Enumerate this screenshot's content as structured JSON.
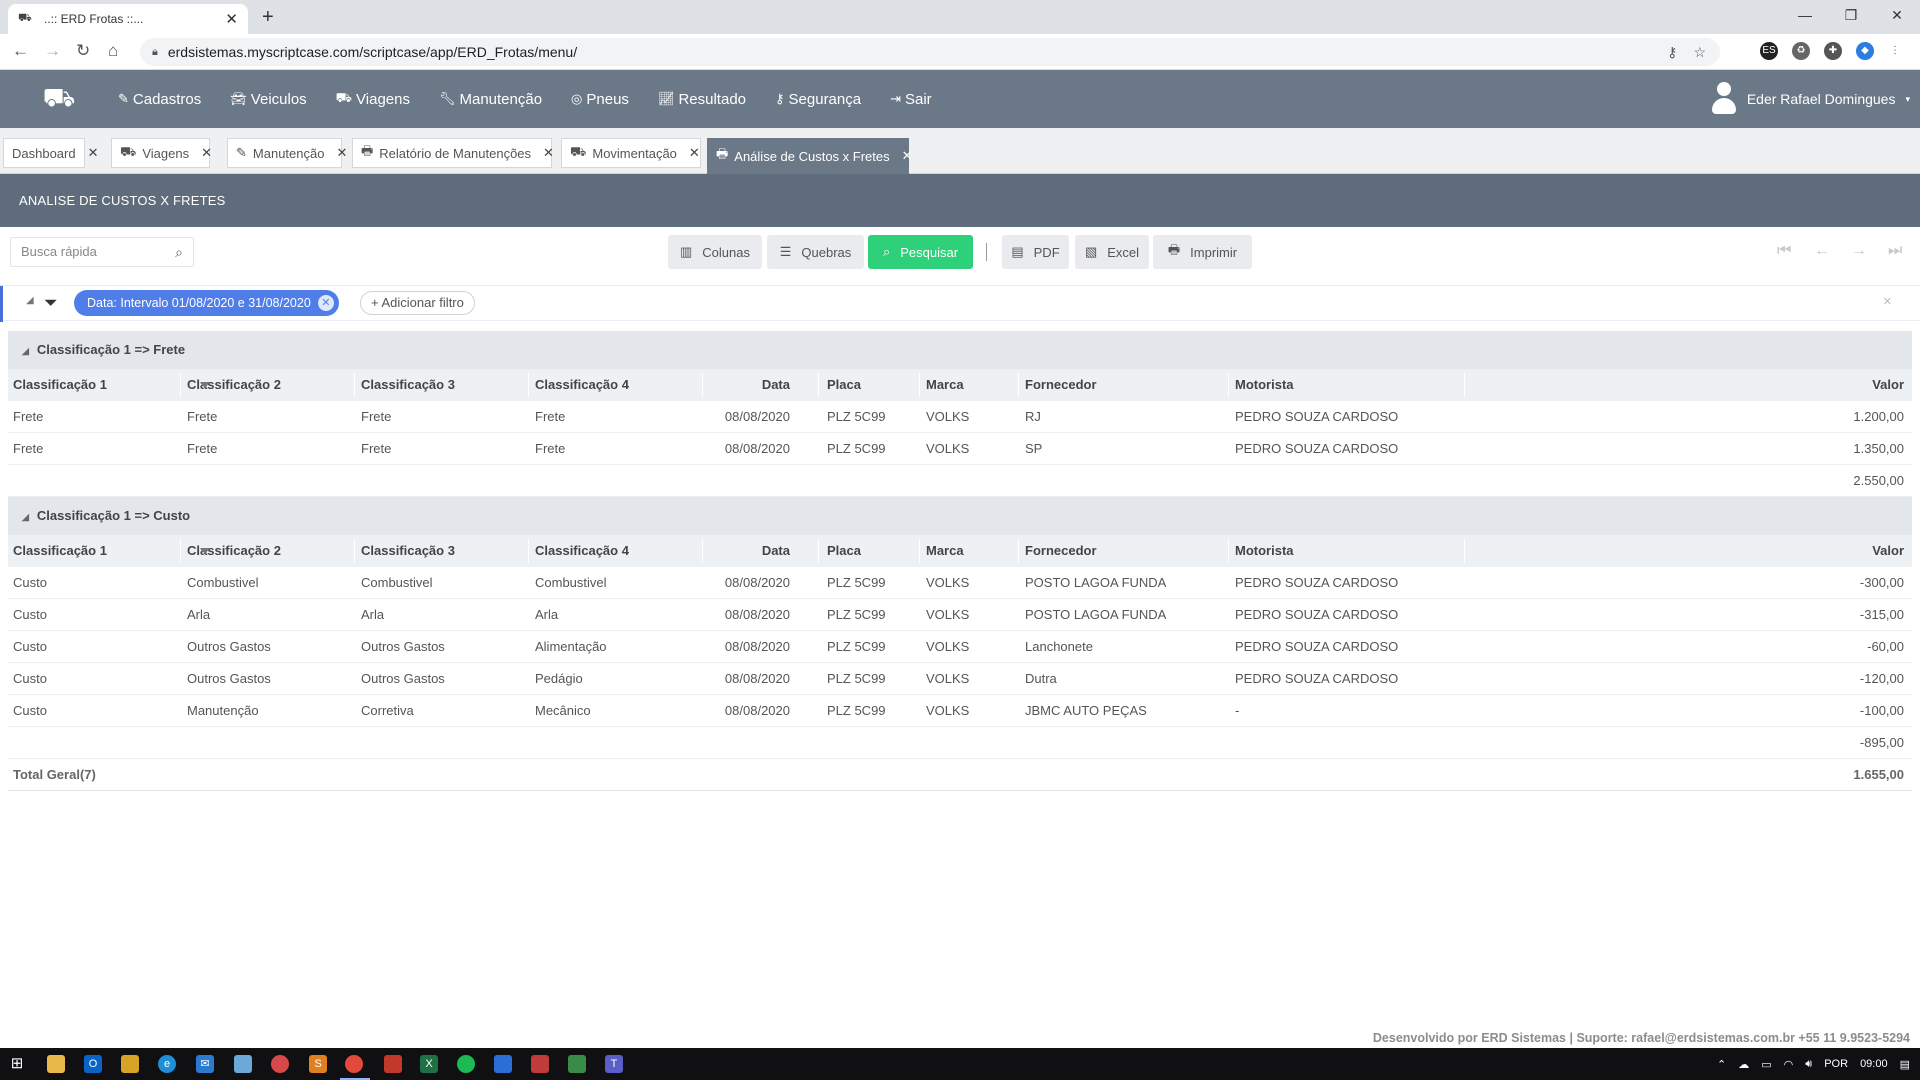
{
  "browser": {
    "tab_title": "..:: ERD Frotas ::...",
    "url": "erdsistemas.myscriptcase.com/scriptcase/app/ERD_Frotas/menu/"
  },
  "app": {
    "nav": [
      {
        "label": "Cadastros",
        "icon": "edit-icon"
      },
      {
        "label": "Veiculos",
        "icon": "car-icon"
      },
      {
        "label": "Viagens",
        "icon": "truck-icon"
      },
      {
        "label": "Manutenção",
        "icon": "wrench-icon"
      },
      {
        "label": "Pneus",
        "icon": "tire-icon"
      },
      {
        "label": "Resultado",
        "icon": "chart-icon"
      },
      {
        "label": "Segurança",
        "icon": "key-icon"
      },
      {
        "label": "Sair",
        "icon": "exit-icon"
      }
    ],
    "user_name": "Eder Rafael Domingues",
    "tabs": [
      "Dashboard",
      "Viagens",
      "Manutenção",
      "Relatório de Manutenções",
      "Movimentação",
      "Análise de Custos x Fretes"
    ],
    "page_title": "ANALISE DE CUSTOS X FRETES"
  },
  "toolbar": {
    "search_placeholder": "Busca rápida",
    "columns": "Colunas",
    "breaks": "Quebras",
    "search": "Pesquisar",
    "pdf": "PDF",
    "excel": "Excel",
    "print": "Imprimir"
  },
  "filter": {
    "chip": "Data: Intervalo 01/08/2020 e 31/08/2020",
    "add": "Adicionar filtro"
  },
  "columns": [
    "Classificação 1",
    "Classificação 2",
    "Classificação 3",
    "Classificação 4",
    "Data",
    "Placa",
    "Marca",
    "Fornecedor",
    "Motorista",
    "Valor"
  ],
  "groups": [
    {
      "title": "Classificação 1 => Frete",
      "rows": [
        [
          "Frete",
          "Frete",
          "Frete",
          "Frete",
          "08/08/2020",
          "PLZ 5C99",
          "VOLKS",
          "RJ",
          "PEDRO SOUZA CARDOSO",
          "1.200,00"
        ],
        [
          "Frete",
          "Frete",
          "Frete",
          "Frete",
          "08/08/2020",
          "PLZ 5C99",
          "VOLKS",
          "SP",
          "PEDRO SOUZA CARDOSO",
          "1.350,00"
        ]
      ],
      "subtotal": "2.550,00"
    },
    {
      "title": "Classificação 1 => Custo",
      "rows": [
        [
          "Custo",
          "Combustivel",
          "Combustivel",
          "Combustivel",
          "08/08/2020",
          "PLZ 5C99",
          "VOLKS",
          "POSTO LAGOA FUNDA",
          "PEDRO SOUZA CARDOSO",
          "-300,00"
        ],
        [
          "Custo",
          "Arla",
          "Arla",
          "Arla",
          "08/08/2020",
          "PLZ 5C99",
          "VOLKS",
          "POSTO LAGOA FUNDA",
          "PEDRO SOUZA CARDOSO",
          "-315,00"
        ],
        [
          "Custo",
          "Outros Gastos",
          "Outros Gastos",
          "Alimentação",
          "08/08/2020",
          "PLZ 5C99",
          "VOLKS",
          "Lanchonete",
          "PEDRO SOUZA CARDOSO",
          "-60,00"
        ],
        [
          "Custo",
          "Outros Gastos",
          "Outros Gastos",
          "Pedágio",
          "08/08/2020",
          "PLZ 5C99",
          "VOLKS",
          "Dutra",
          "PEDRO SOUZA CARDOSO",
          "-120,00"
        ],
        [
          "Custo",
          "Manutenção",
          "Corretiva",
          "Mecânico",
          "08/08/2020",
          "PLZ 5C99",
          "VOLKS",
          "JBMC AUTO PEÇAS",
          "-",
          "-100,00"
        ]
      ],
      "subtotal": "-895,00"
    }
  ],
  "total": {
    "label": "Total Geral(7)",
    "value": "1.655,00"
  },
  "footer": "Desenvolvido por ERD Sistemas | Suporte: rafael@erdsistemas.com.br +55 11 9.9523-5294",
  "taskbar": {
    "lang": "POR",
    "time": "09:00"
  },
  "colors": {
    "nav": "#6b7887",
    "title_bar": "#5f6c7b",
    "accent_green": "#2ed17a",
    "chip_blue": "#4f7ee8"
  }
}
